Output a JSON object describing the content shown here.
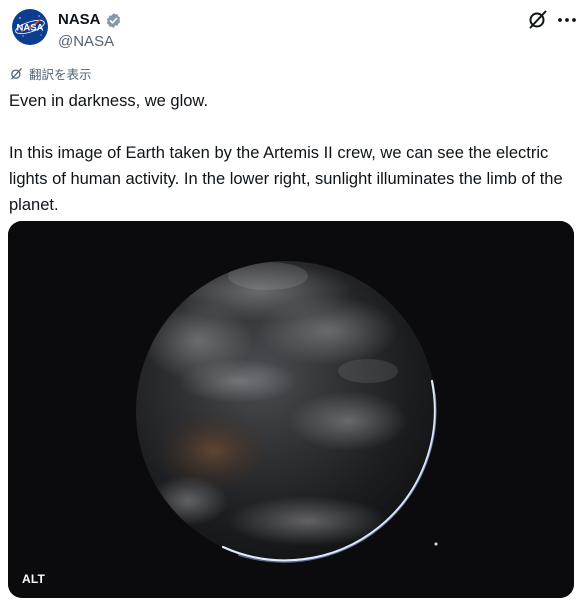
{
  "post": {
    "author": {
      "name": "NASA",
      "handle": "@NASA",
      "avatar_text": "NASA",
      "verified": true,
      "verified_color": "#829aab"
    },
    "translate_label": "翻訳を表示",
    "body": [
      "Even in darkness, we glow.",
      "In this image of Earth taken by the Artemis II crew, we can see the electric lights of human activity. In the lower right, sunlight illuminates the limb of the planet."
    ],
    "media": {
      "alt_badge": "ALT"
    }
  },
  "icons": {
    "grok": "grok-icon",
    "more": "more-options-icon",
    "translate": "translate-icon",
    "verified": "verified-badge-icon"
  },
  "colors": {
    "text": "#0f1419",
    "secondary": "#536471",
    "nasa_blue": "#0b3d91",
    "nasa_red": "#fc3d21"
  }
}
